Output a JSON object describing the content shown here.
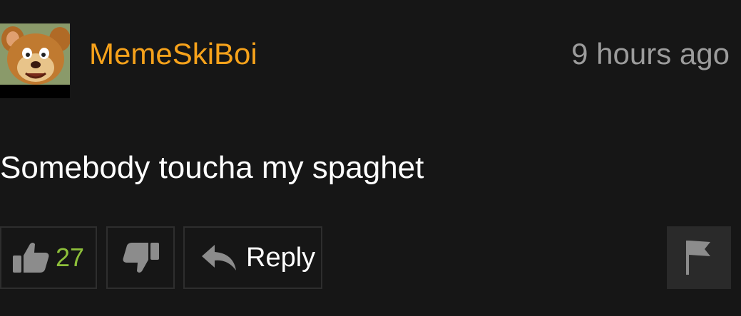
{
  "comment": {
    "username": "MemeSkiBoi",
    "timestamp": "9 hours ago",
    "text": "Somebody toucha my spaghet"
  },
  "actions": {
    "like_count": "27",
    "reply_label": "Reply"
  },
  "icons": {
    "avatar": "cartoon-bear-avatar",
    "like": "thumbs-up-icon",
    "dislike": "thumbs-down-icon",
    "reply": "reply-arrow-icon",
    "flag": "flag-icon"
  },
  "colors": {
    "background": "#161616",
    "username": "#f6a21b",
    "timestamp": "#9c9c9c",
    "like_count": "#8dbf3a",
    "text": "#ffffff"
  }
}
